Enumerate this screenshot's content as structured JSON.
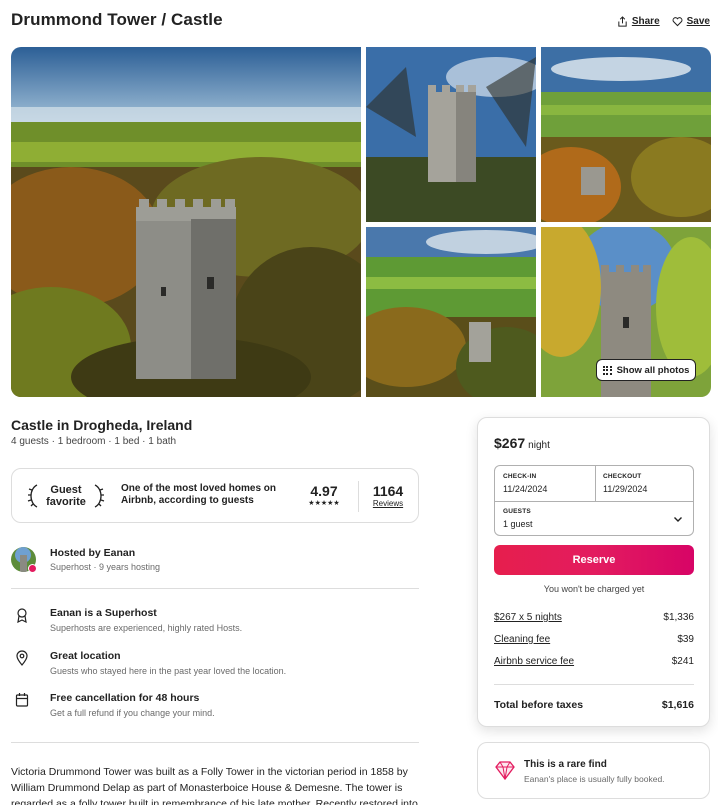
{
  "listing": {
    "title": "Drummond Tower / Castle",
    "actions": {
      "share": "Share",
      "save": "Save"
    },
    "show_all_photos": "Show all photos",
    "subtitle": "Castle in Drogheda, Ireland",
    "overview": "4 guests · 1 bedroom · 1 bed · 1 bath"
  },
  "guest_favorite": {
    "badge": "Guest favorite",
    "description": "One of the most loved homes on Airbnb, according to guests",
    "rating": "4.97",
    "stars": "★★★★★",
    "reviews_count": "1164",
    "reviews_label": "Reviews"
  },
  "host": {
    "name": "Hosted by Eanan",
    "meta": "Superhost · 9 years hosting"
  },
  "features": [
    {
      "icon": "medal-icon",
      "title": "Eanan is a Superhost",
      "subtitle": "Superhosts are experienced, highly rated Hosts."
    },
    {
      "icon": "location-pin-icon",
      "title": "Great location",
      "subtitle": "Guests who stayed here in the past year loved the location."
    },
    {
      "icon": "calendar-icon",
      "title": "Free cancellation for 48 hours",
      "subtitle": "Get a full refund if you change your mind."
    }
  ],
  "description": "Victoria Drummond Tower was built as a Folly Tower in the victorian period in 1858 by William Drummond Delap as part of Monasterboice House & Demesne.  The tower is regarded as a folly tower built in remembrance of his late mother. Recently restored into",
  "booking": {
    "price": "$267",
    "price_unit": "night",
    "checkin_label": "CHECK-IN",
    "checkin_value": "11/24/2024",
    "checkout_label": "CHECKOUT",
    "checkout_value": "11/29/2024",
    "guests_label": "GUESTS",
    "guests_value": "1 guest",
    "reserve": "Reserve",
    "no_charge": "You won't be charged yet",
    "lines": [
      {
        "label": "$267 x 5 nights",
        "amount": "$1,336"
      },
      {
        "label": "Cleaning fee",
        "amount": "$39"
      },
      {
        "label": "Airbnb service fee",
        "amount": "$241"
      }
    ],
    "total_label": "Total before taxes",
    "total_amount": "$1,616"
  },
  "rare_find": {
    "title": "This is a rare find",
    "subtitle": "Eanan's place is usually fully booked."
  },
  "colors": {
    "brand": "#e31c5f",
    "text": "#222222",
    "muted": "#6a6a6a",
    "border": "#dddddd"
  }
}
